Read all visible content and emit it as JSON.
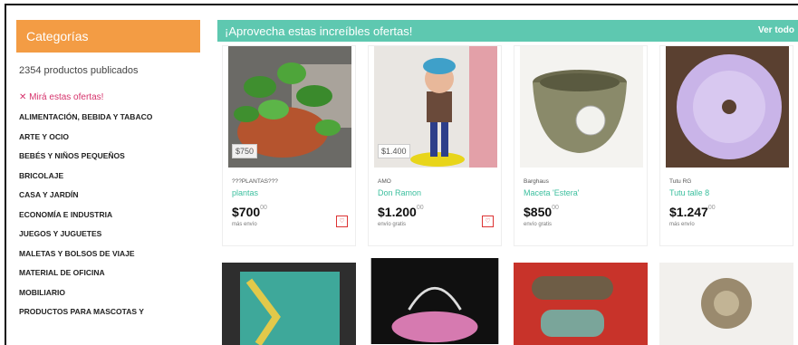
{
  "sidebar": {
    "title": "Categorías",
    "count_text": "2354 productos publicados",
    "promo_text": "✕ Mirá estas ofertas!",
    "categories": [
      "ALIMENTACIÓN, BEBIDA Y TABACO",
      "ARTE Y OCIO",
      "BEBÉS Y NIÑOS PEQUEÑOS",
      "BRICOLAJE",
      "CASA Y JARDÍN",
      "ECONOMÍA E INDUSTRIA",
      "JUEGOS Y JUGUETES",
      "MALETAS Y BOLSOS DE VIAJE",
      "MATERIAL DE OFICINA",
      "MOBILIARIO",
      "PRODUCTOS PARA MASCOTAS Y"
    ]
  },
  "banner": {
    "title": "¡Aprovecha estas increíbles ofertas!",
    "link": "Ver todo"
  },
  "products": [
    {
      "tag": "$750",
      "seller": "???PLANTAS???",
      "name": "plantas",
      "price": "$700",
      "cents": "00",
      "shipping": "más envío"
    },
    {
      "tag": "$1.400",
      "seller": "AMO",
      "name": "Don Ramon",
      "price": "$1.200",
      "cents": "00",
      "shipping": "envío gratis"
    },
    {
      "tag": "",
      "seller": "Barghaus",
      "name": "Maceta 'Estera'",
      "price": "$850",
      "cents": "00",
      "shipping": "envío gratis"
    },
    {
      "tag": "",
      "seller": "Tutu RG",
      "name": "Tutu talle 8",
      "price": "$1.247",
      "cents": "00",
      "shipping": "más envío"
    }
  ],
  "icons": {
    "favorite": "heart-outline-icon"
  },
  "colors": {
    "accent": "#5ec8b0",
    "category_header": "#f39c44",
    "promo": "#d6336c",
    "link": "#3bbf9e"
  }
}
